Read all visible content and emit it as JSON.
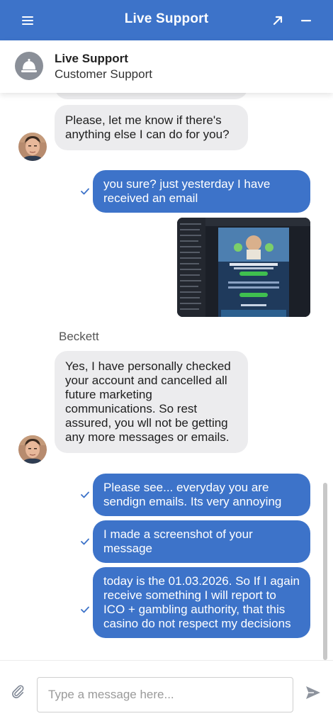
{
  "header": {
    "title": "Live Support"
  },
  "agent": {
    "name": "Live Support",
    "role": "Customer Support"
  },
  "messages": [
    {
      "from": "agent",
      "text": ""
    },
    {
      "from": "agent",
      "text": "Please, let me know if there's anything else I can do for you?"
    },
    {
      "from": "user",
      "text": "you sure? just yesterday I have received an email",
      "status": "delivered"
    },
    {
      "from": "user",
      "type": "image",
      "status": "delivered"
    },
    {
      "from": "agent",
      "sender": "Beckett",
      "text": "Yes, I have personally checked your account and cancelled all future marketing communications. So rest assured, you wll not be getting any more messages or emails."
    },
    {
      "from": "user",
      "text": "Please see... everyday you are sendign emails. Its very annoying",
      "status": "delivered"
    },
    {
      "from": "user",
      "text": "I made a screenshot of your message",
      "status": "delivered"
    },
    {
      "from": "user",
      "text": "today is the 01.03.2026. So If I again receive something I will report to ICO + gambling authority, that this casino do not respect my decisions",
      "status": "delivered"
    }
  ],
  "composer": {
    "placeholder": "Type a message here..."
  },
  "colors": {
    "brand": "#3d73c9",
    "incoming_bubble": "#ececee"
  },
  "icons": [
    "menu-icon",
    "popout-icon",
    "minimize-icon",
    "concierge-bell-icon",
    "check-icon",
    "paperclip-icon",
    "send-icon"
  ]
}
